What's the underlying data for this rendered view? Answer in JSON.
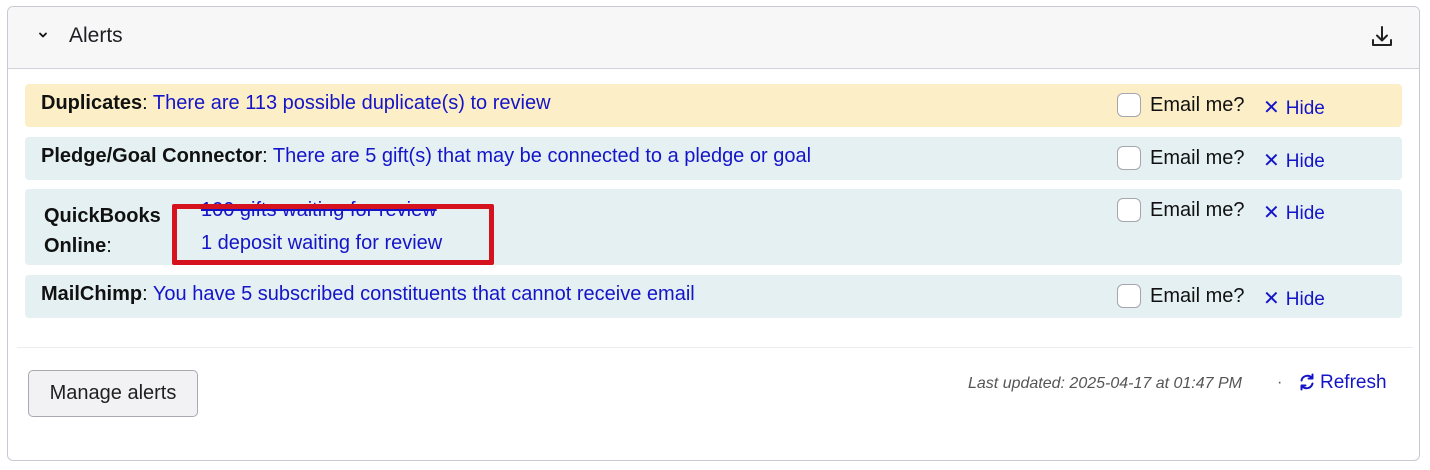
{
  "panel": {
    "title": "Alerts",
    "collapse_icon": "chevron-down-icon",
    "download_icon": "download-icon"
  },
  "alerts": [
    {
      "source": "Duplicates",
      "separator": ":",
      "message": "There are 113 possible duplicate(s) to review",
      "email_label": "Email me?",
      "hide_label": "Hide",
      "color": "#fcefc7"
    },
    {
      "source": "Pledge/Goal Connector",
      "separator": ":",
      "message": "There are 5 gift(s) that may be connected to a pledge or goal",
      "email_label": "Email me?",
      "hide_label": "Hide",
      "color": "#e5f0f2"
    },
    {
      "source_line1": "QuickBooks",
      "source_line2": "Online",
      "separator": ":",
      "links": [
        "100 gifts waiting for review",
        "1 deposit waiting for review"
      ],
      "email_label": "Email me?",
      "hide_label": "Hide",
      "color": "#e5f0f2"
    },
    {
      "source": "MailChimp",
      "separator": ":",
      "message": "You have 5 subscribed constituents that cannot receive email",
      "email_label": "Email me?",
      "hide_label": "Hide",
      "color": "#e5f0f2"
    }
  ],
  "footer": {
    "manage_label": "Manage alerts",
    "last_updated": "Last updated: 2025-04-17 at 01:47 PM",
    "dot": "·",
    "refresh_label": "Refresh"
  },
  "colors": {
    "link": "#1414c8",
    "highlight_border": "#d4131f"
  }
}
